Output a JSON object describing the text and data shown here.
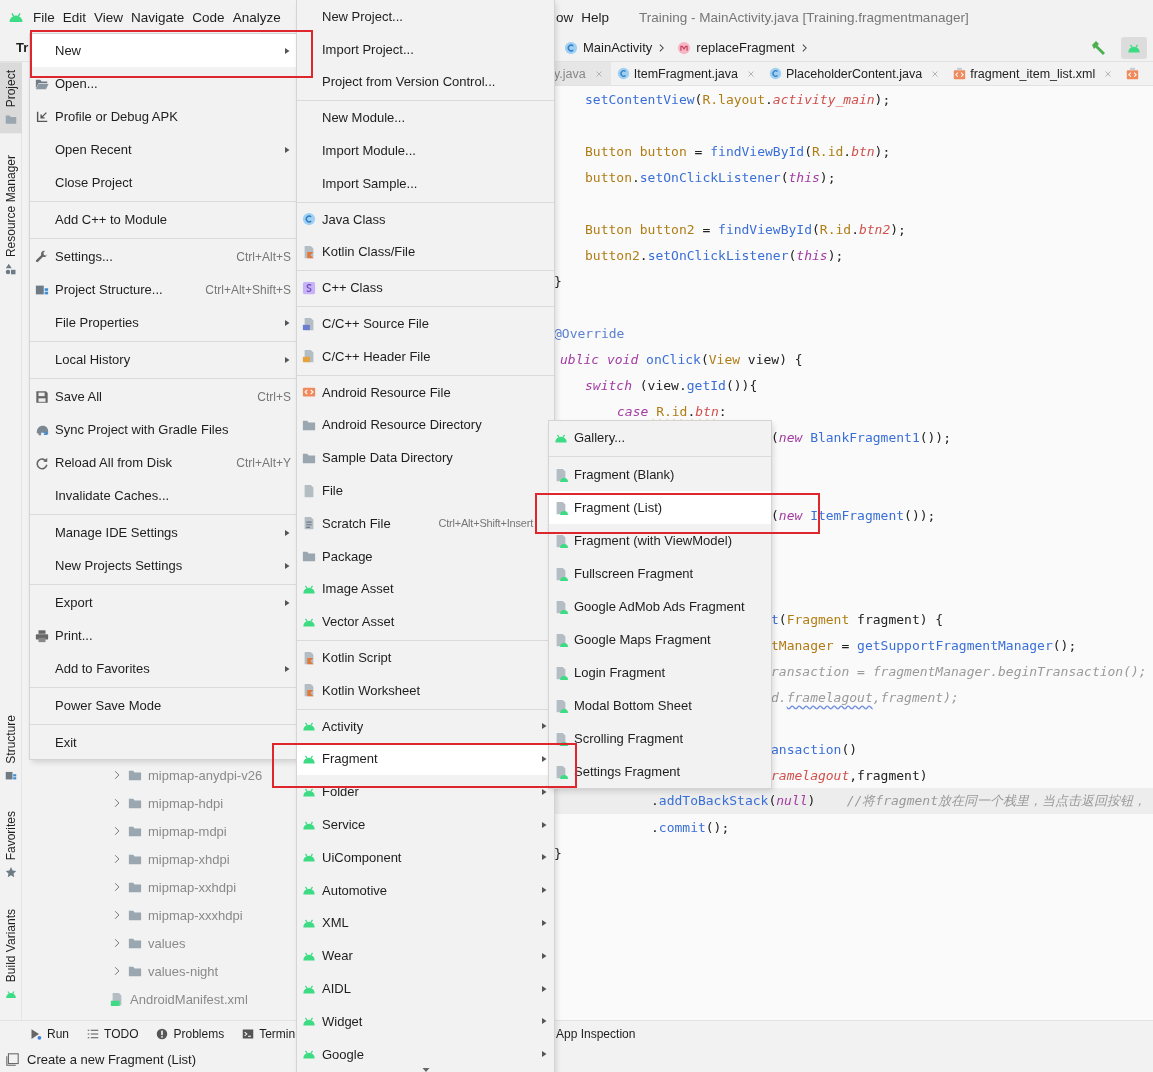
{
  "menu_bar": {
    "left_items": [
      "File",
      "Edit",
      "View",
      "Navigate",
      "Code",
      "Analyze"
    ],
    "right_items": [
      "ow",
      "Help"
    ],
    "title": "Training - MainActivity.java [Training.fragmentmanager]"
  },
  "nav_bar": {
    "project": "Tr",
    "breadcrumbs": [
      {
        "label": "MainActivity"
      },
      {
        "label": "replaceFragment"
      }
    ]
  },
  "tool_strip": {
    "top": [
      {
        "label": "Project",
        "selected": true
      },
      {
        "label": "Resource Manager",
        "selected": false
      }
    ],
    "bottom": [
      {
        "label": "Structure",
        "selected": false
      },
      {
        "label": "Favorites",
        "selected": false
      },
      {
        "label": "Build Variants",
        "selected": false
      }
    ]
  },
  "project_tree": {
    "items": [
      {
        "label": "mipmap-anydpi-v26",
        "kind": "folder",
        "expanded": false
      },
      {
        "label": "mipmap-hdpi",
        "kind": "folder",
        "expanded": false
      },
      {
        "label": "mipmap-mdpi",
        "kind": "folder",
        "expanded": false
      },
      {
        "label": "mipmap-xhdpi",
        "kind": "folder",
        "expanded": false
      },
      {
        "label": "mipmap-xxhdpi",
        "kind": "folder",
        "expanded": false
      },
      {
        "label": "mipmap-xxxhdpi",
        "kind": "folder",
        "expanded": false
      },
      {
        "label": "values",
        "kind": "folder",
        "expanded": false
      },
      {
        "label": "values-night",
        "kind": "folder",
        "expanded": false
      },
      {
        "label": "AndroidManifest.xml",
        "kind": "manifest"
      }
    ]
  },
  "editor_tabs": [
    {
      "label": "y.java",
      "selected": true
    },
    {
      "label": "ItemFragment.java",
      "selected": false
    },
    {
      "label": "PlaceholderContent.java",
      "selected": false
    },
    {
      "label": "fragment_item_list.xml",
      "selected": false
    },
    {
      "selected": false
    }
  ],
  "code_lines": [
    {
      "kind": "indent-1",
      "current": false,
      "tokens": [
        {
          "text": "setContentView",
          "kind": "method"
        },
        {
          "text": "(",
          "kind": "plain"
        },
        {
          "text": "R.layout",
          "kind": "type"
        },
        {
          "text": ".",
          "kind": "plain"
        },
        {
          "text": "activity_main",
          "kind": "field"
        },
        {
          "text": ");",
          "kind": "plain"
        }
      ]
    },
    {
      "kind": "blank"
    },
    {
      "kind": "indent-1",
      "current": false,
      "tokens": [
        {
          "text": "Button button",
          "kind": "type"
        },
        {
          "text": " = ",
          "kind": "plain"
        },
        {
          "text": "findViewById",
          "kind": "method"
        },
        {
          "text": "(",
          "kind": "plain"
        },
        {
          "text": "R.id",
          "kind": "type"
        },
        {
          "text": ".",
          "kind": "plain"
        },
        {
          "text": "btn",
          "kind": "field"
        },
        {
          "text": ");",
          "kind": "plain"
        }
      ]
    },
    {
      "kind": "indent-1",
      "current": false,
      "tokens": [
        {
          "text": "button",
          "kind": "type"
        },
        {
          "text": ".",
          "kind": "plain"
        },
        {
          "text": "setOnClickListener",
          "kind": "method"
        },
        {
          "text": "(",
          "kind": "plain"
        },
        {
          "text": "this",
          "kind": "keyword"
        },
        {
          "text": ");",
          "kind": "plain"
        }
      ]
    },
    {
      "kind": "blank"
    },
    {
      "kind": "indent-1",
      "current": false,
      "tokens": [
        {
          "text": "Button button2",
          "kind": "type"
        },
        {
          "text": " = ",
          "kind": "plain"
        },
        {
          "text": "findViewById",
          "kind": "method"
        },
        {
          "text": "(",
          "kind": "plain"
        },
        {
          "text": "R.id",
          "kind": "type"
        },
        {
          "text": ".",
          "kind": "plain"
        },
        {
          "text": "btn2",
          "kind": "field"
        },
        {
          "text": ");",
          "kind": "plain"
        }
      ]
    },
    {
      "kind": "indent-1",
      "current": false,
      "tokens": [
        {
          "text": "button2",
          "kind": "type"
        },
        {
          "text": ".",
          "kind": "plain"
        },
        {
          "text": "setOnClickListener",
          "kind": "method"
        },
        {
          "text": "(",
          "kind": "plain"
        },
        {
          "text": "this",
          "kind": "keyword"
        },
        {
          "text": ");",
          "kind": "plain"
        }
      ]
    },
    {
      "kind": "edge",
      "current": false,
      "tokens": [
        {
          "text": "}",
          "kind": "plain"
        }
      ]
    },
    {
      "kind": "blank"
    },
    {
      "kind": "edge",
      "current": false,
      "tokens": [
        {
          "text": "@Override",
          "kind": "annotation"
        }
      ]
    },
    {
      "kind": "edge-cut",
      "current": false,
      "tokens": [
        {
          "text": "ublic void",
          "kind": "keyword"
        },
        {
          "text": " onClick",
          "kind": "method"
        },
        {
          "text": "(",
          "kind": "plain"
        },
        {
          "text": "View",
          "kind": "type"
        },
        {
          "text": " view) {",
          "kind": "plain"
        }
      ]
    },
    {
      "kind": "indent-1",
      "current": false,
      "tokens": [
        {
          "text": "switch",
          "kind": "keyword"
        },
        {
          "text": " (view.",
          "kind": "plain"
        },
        {
          "text": "getId",
          "kind": "method"
        },
        {
          "text": "()){",
          "kind": "plain"
        }
      ]
    },
    {
      "kind": "indent-2",
      "current": false,
      "tokens": [
        {
          "text": "case",
          "kind": "keyword"
        },
        {
          "text": " R.id",
          "kind": "warntype"
        },
        {
          "text": ".",
          "kind": "warnplain"
        },
        {
          "text": "btn",
          "kind": "warnfield"
        },
        {
          "text": ":",
          "kind": "plain"
        }
      ]
    },
    {
      "kind": "past-menu",
      "current": false,
      "tokens": [
        {
          "text": "(",
          "kind": "plain"
        },
        {
          "text": "new",
          "kind": "keyword"
        },
        {
          "text": " BlankFragment1",
          "kind": "method"
        },
        {
          "text": "());",
          "kind": "plain"
        }
      ]
    },
    {
      "kind": "blank"
    },
    {
      "kind": "blank"
    },
    {
      "kind": "past-menu",
      "current": false,
      "tokens": [
        {
          "text": "(",
          "kind": "plain"
        },
        {
          "text": "new",
          "kind": "keyword"
        },
        {
          "text": " ItemFragment",
          "kind": "method"
        },
        {
          "text": "());",
          "kind": "plain"
        }
      ]
    },
    {
      "kind": "blank"
    },
    {
      "kind": "blank"
    },
    {
      "kind": "blank"
    },
    {
      "kind": "past-menu",
      "current": false,
      "tokens": [
        {
          "text": "t",
          "kind": "method"
        },
        {
          "text": "(",
          "kind": "plain"
        },
        {
          "text": "Fragment",
          "kind": "type"
        },
        {
          "text": " fragment) {",
          "kind": "plain"
        }
      ]
    },
    {
      "kind": "past-menu",
      "current": false,
      "tokens": [
        {
          "text": "tManager",
          "kind": "type"
        },
        {
          "text": " = ",
          "kind": "plain"
        },
        {
          "text": "getSupportFragmentManager",
          "kind": "method"
        },
        {
          "text": "();",
          "kind": "plain"
        }
      ]
    },
    {
      "kind": "past-menu",
      "current": false,
      "tokens": [
        {
          "text": "ransaction = fragmentManager.beginTransaction();",
          "kind": "unused"
        }
      ]
    },
    {
      "kind": "past-menu",
      "current": false,
      "tokens": [
        {
          "text": "d.",
          "kind": "unused"
        },
        {
          "text": "framelagout",
          "kind": "typo"
        },
        {
          "text": ",fragment);",
          "kind": "unused"
        }
      ]
    },
    {
      "kind": "blank"
    },
    {
      "kind": "past-menu",
      "current": false,
      "tokens": [
        {
          "text": "ansaction",
          "kind": "method"
        },
        {
          "text": "()",
          "kind": "plain"
        }
      ]
    },
    {
      "kind": "past-menu",
      "current": false,
      "tokens": [
        {
          "text": "ramelagout",
          "kind": "field"
        },
        {
          "text": ",fragment)",
          "kind": "plain"
        }
      ]
    },
    {
      "kind": "indent-3",
      "current": true,
      "tokens": [
        {
          "text": ".",
          "kind": "plain"
        },
        {
          "text": "addToBackStack",
          "kind": "method"
        },
        {
          "text": "(",
          "kind": "plain"
        },
        {
          "text": "null",
          "kind": "keyword"
        },
        {
          "text": ")    ",
          "kind": "plain"
        },
        {
          "text": "//将fragment放在同一个栈里，当点击返回按钮，",
          "kind": "comment"
        }
      ]
    },
    {
      "kind": "indent-3",
      "current": false,
      "tokens": [
        {
          "text": ".",
          "kind": "plain"
        },
        {
          "text": "commit",
          "kind": "method"
        },
        {
          "text": "();",
          "kind": "plain"
        }
      ]
    },
    {
      "kind": "edge",
      "current": false,
      "tokens": [
        {
          "text": "}",
          "kind": "plain"
        }
      ]
    }
  ],
  "bottom_tools": {
    "left": [
      {
        "label": "Run"
      },
      {
        "label": "TODO"
      },
      {
        "label": "Problems"
      },
      {
        "label": "Termin"
      }
    ],
    "right": [
      {
        "label": "App Inspection"
      }
    ]
  },
  "status_bar": {
    "message": "Create a new Fragment (List)"
  },
  "file_menu": {
    "items": [
      {
        "kind": "item",
        "label": "New",
        "submenu": true,
        "selected": true,
        "annotated": true
      },
      {
        "kind": "item",
        "label": "Open...",
        "submenu": false,
        "selected": false,
        "annotated": false
      },
      {
        "kind": "item",
        "label": "Profile or Debug APK",
        "submenu": false,
        "selected": false,
        "annotated": false
      },
      {
        "kind": "item",
        "label": "Open Recent",
        "submenu": true,
        "selected": false,
        "annotated": false
      },
      {
        "kind": "item",
        "label": "Close Project",
        "submenu": false,
        "selected": false,
        "annotated": false
      },
      {
        "kind": "separator"
      },
      {
        "kind": "item",
        "label": "Add C++ to Module",
        "submenu": false,
        "selected": false,
        "annotated": false
      },
      {
        "kind": "separator"
      },
      {
        "kind": "item",
        "label": "Settings...",
        "shortcut": "Ctrl+Alt+S",
        "submenu": false,
        "selected": false,
        "annotated": false
      },
      {
        "kind": "item",
        "label": "Project Structure...",
        "shortcut": "Ctrl+Alt+Shift+S",
        "submenu": false,
        "selected": false,
        "annotated": false
      },
      {
        "kind": "item",
        "label": "File Properties",
        "submenu": true,
        "selected": false,
        "annotated": false
      },
      {
        "kind": "separator"
      },
      {
        "kind": "item",
        "label": "Local History",
        "submenu": true,
        "selected": false,
        "annotated": false
      },
      {
        "kind": "separator"
      },
      {
        "kind": "item",
        "label": "Save All",
        "shortcut": "Ctrl+S",
        "submenu": false,
        "selected": false,
        "annotated": false
      },
      {
        "kind": "item",
        "label": "Sync Project with Gradle Files",
        "submenu": false,
        "selected": false,
        "annotated": false
      },
      {
        "kind": "item",
        "label": "Reload All from Disk",
        "shortcut": "Ctrl+Alt+Y",
        "submenu": false,
        "selected": false,
        "annotated": false
      },
      {
        "kind": "item",
        "label": "Invalidate Caches...",
        "submenu": false,
        "selected": false,
        "annotated": false
      },
      {
        "kind": "separator"
      },
      {
        "kind": "item",
        "label": "Manage IDE Settings",
        "submenu": true,
        "selected": false,
        "annotated": false
      },
      {
        "kind": "item",
        "label": "New Projects Settings",
        "submenu": true,
        "selected": false,
        "annotated": false
      },
      {
        "kind": "separator"
      },
      {
        "kind": "item",
        "label": "Export",
        "submenu": true,
        "selected": false,
        "annotated": false
      },
      {
        "kind": "item",
        "label": "Print...",
        "submenu": false,
        "selected": false,
        "annotated": false
      },
      {
        "kind": "item",
        "label": "Add to Favorites",
        "submenu": true,
        "selected": false,
        "annotated": false
      },
      {
        "kind": "separator"
      },
      {
        "kind": "item",
        "label": "Power Save Mode",
        "submenu": false,
        "selected": false,
        "annotated": false
      },
      {
        "kind": "separator"
      },
      {
        "kind": "item",
        "label": "Exit",
        "submenu": false,
        "selected": false,
        "annotated": false
      }
    ]
  },
  "new_menu": {
    "items": [
      {
        "kind": "item",
        "label": "New Project...",
        "submenu": false,
        "selected": false,
        "annotated": false
      },
      {
        "kind": "item",
        "label": "Import Project...",
        "submenu": false,
        "selected": false,
        "annotated": false
      },
      {
        "kind": "item",
        "label": "Project from Version Control...",
        "submenu": false,
        "selected": false,
        "annotated": false
      },
      {
        "kind": "separator"
      },
      {
        "kind": "item",
        "label": "New Module...",
        "submenu": false,
        "selected": false,
        "annotated": false
      },
      {
        "kind": "item",
        "label": "Import Module...",
        "submenu": false,
        "selected": false,
        "annotated": false
      },
      {
        "kind": "item",
        "label": "Import Sample...",
        "submenu": false,
        "selected": false,
        "annotated": false
      },
      {
        "kind": "separator"
      },
      {
        "kind": "item",
        "label": "Java Class",
        "submenu": false,
        "selected": false,
        "annotated": false
      },
      {
        "kind": "item",
        "label": "Kotlin Class/File",
        "submenu": false,
        "selected": false,
        "annotated": false
      },
      {
        "kind": "separator"
      },
      {
        "kind": "item",
        "label": "C++ Class",
        "submenu": false,
        "selected": false,
        "annotated": false
      },
      {
        "kind": "separator"
      },
      {
        "kind": "item",
        "label": "C/C++ Source File",
        "submenu": false,
        "selected": false,
        "annotated": false
      },
      {
        "kind": "item",
        "label": "C/C++ Header File",
        "submenu": false,
        "selected": false,
        "annotated": false
      },
      {
        "kind": "separator"
      },
      {
        "kind": "item",
        "label": "Android Resource File",
        "submenu": false,
        "selected": false,
        "annotated": false
      },
      {
        "kind": "item",
        "label": "Android Resource Directory",
        "submenu": false,
        "selected": false,
        "annotated": false
      },
      {
        "kind": "item",
        "label": "Sample Data Directory",
        "submenu": false,
        "selected": false,
        "annotated": false
      },
      {
        "kind": "item",
        "label": "File",
        "submenu": false,
        "selected": false,
        "annotated": false
      },
      {
        "kind": "item",
        "label": "Scratch File",
        "shortcut": "Ctrl+Alt+Shift+Insert",
        "submenu": false,
        "selected": false,
        "annotated": false
      },
      {
        "kind": "item",
        "label": "Package",
        "submenu": false,
        "selected": false,
        "annotated": false
      },
      {
        "kind": "item",
        "label": "Image Asset",
        "submenu": false,
        "selected": false,
        "annotated": false
      },
      {
        "kind": "item",
        "label": "Vector Asset",
        "submenu": false,
        "selected": false,
        "annotated": false
      },
      {
        "kind": "separator"
      },
      {
        "kind": "item",
        "label": "Kotlin Script",
        "submenu": false,
        "selected": false,
        "annotated": false
      },
      {
        "kind": "item",
        "label": "Kotlin Worksheet",
        "submenu": false,
        "selected": false,
        "annotated": false
      },
      {
        "kind": "separator"
      },
      {
        "kind": "item",
        "label": "Activity",
        "submenu": true,
        "selected": false,
        "annotated": false
      },
      {
        "kind": "item",
        "label": "Fragment",
        "submenu": true,
        "selected": true,
        "annotated": true
      },
      {
        "kind": "item",
        "label": "Folder",
        "submenu": true,
        "selected": false,
        "annotated": false
      },
      {
        "kind": "item",
        "label": "Service",
        "submenu": true,
        "selected": false,
        "annotated": false
      },
      {
        "kind": "item",
        "label": "UiComponent",
        "submenu": true,
        "selected": false,
        "annotated": false
      },
      {
        "kind": "item",
        "label": "Automotive",
        "submenu": true,
        "selected": false,
        "annotated": false
      },
      {
        "kind": "item",
        "label": "XML",
        "submenu": true,
        "selected": false,
        "annotated": false
      },
      {
        "kind": "item",
        "label": "Wear",
        "submenu": true,
        "selected": false,
        "annotated": false
      },
      {
        "kind": "item",
        "label": "AIDL",
        "submenu": true,
        "selected": false,
        "annotated": false
      },
      {
        "kind": "item",
        "label": "Widget",
        "submenu": true,
        "selected": false,
        "annotated": false
      },
      {
        "kind": "item",
        "label": "Google",
        "submenu": true,
        "selected": false,
        "annotated": false
      }
    ]
  },
  "fragment_menu": {
    "items": [
      {
        "kind": "item",
        "label": "Gallery...",
        "submenu": false,
        "selected": false,
        "annotated": false
      },
      {
        "kind": "separator"
      },
      {
        "kind": "item",
        "label": "Fragment (Blank)",
        "submenu": false,
        "selected": false,
        "annotated": false
      },
      {
        "kind": "item",
        "label": "Fragment (List)",
        "submenu": false,
        "selected": true,
        "annotated": true
      },
      {
        "kind": "item",
        "label": "Fragment (with ViewModel)",
        "submenu": false,
        "selected": false,
        "annotated": false
      },
      {
        "kind": "item",
        "label": "Fullscreen Fragment",
        "submenu": false,
        "selected": false,
        "annotated": false
      },
      {
        "kind": "item",
        "label": "Google AdMob Ads Fragment",
        "submenu": false,
        "selected": false,
        "annotated": false
      },
      {
        "kind": "item",
        "label": "Google Maps Fragment",
        "submenu": false,
        "selected": false,
        "annotated": false
      },
      {
        "kind": "item",
        "label": "Login Fragment",
        "submenu": false,
        "selected": false,
        "annotated": false
      },
      {
        "kind": "item",
        "label": "Modal Bottom Sheet",
        "submenu": false,
        "selected": false,
        "annotated": false
      },
      {
        "kind": "item",
        "label": "Scrolling Fragment",
        "submenu": false,
        "selected": false,
        "annotated": false
      },
      {
        "kind": "item",
        "label": "Settings Fragment",
        "submenu": false,
        "selected": false,
        "annotated": false
      }
    ]
  }
}
